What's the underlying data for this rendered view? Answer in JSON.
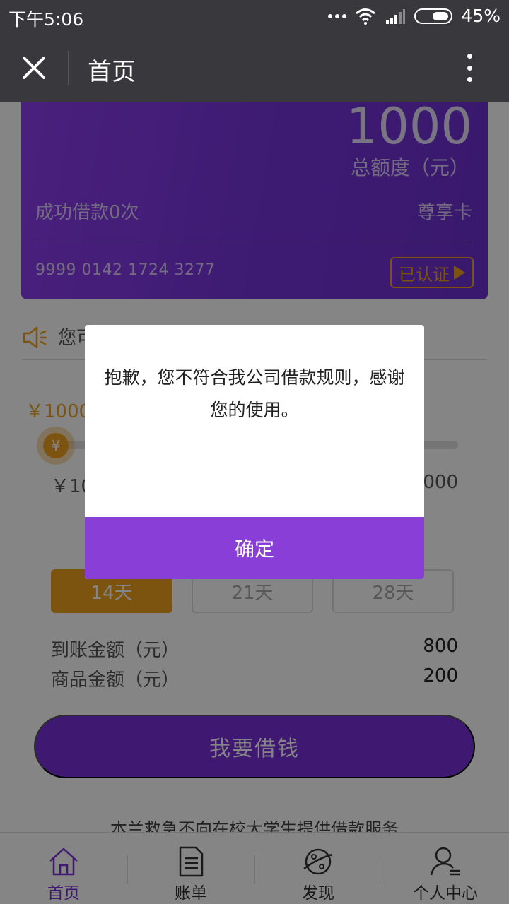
{
  "status_bar": {
    "time": "下午5:06",
    "battery": "45%"
  },
  "header": {
    "title": "首页"
  },
  "card": {
    "amount": "1000",
    "total_label": "总额度（元）",
    "success_text": "成功借款0次",
    "tier": "尊享卡",
    "card_number": "9999 0142 1724 3277",
    "verified_label": "已认证"
  },
  "notice": {
    "text": "您可"
  },
  "loan": {
    "selected_amount": "￥1000",
    "range_min": "￥10",
    "range_max": "000",
    "terms": [
      "14天",
      "21天",
      "28天"
    ],
    "arrival_label": "到账金额（元）",
    "arrival_value": "800",
    "goods_label": "商品金额（元）",
    "goods_value": "200",
    "borrow_button": "我要借钱",
    "disclaimer": "本兰救急不向在校大学生提供借款服务"
  },
  "tabs": [
    "首页",
    "账单",
    "发现",
    "个人中心"
  ],
  "dialog": {
    "message": "抱歉，您不符合我公司借款规则，感谢您的使用。",
    "ok_label": "确定"
  },
  "colors": {
    "accent": "#8a3ed8",
    "orange": "#f0a020",
    "topbar": "#38383d"
  }
}
